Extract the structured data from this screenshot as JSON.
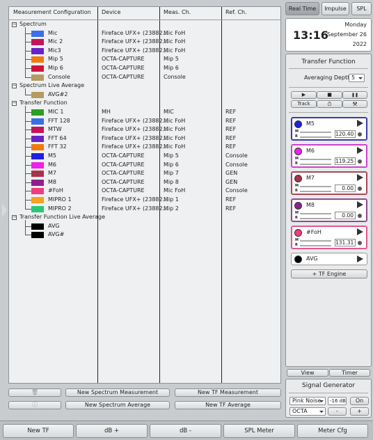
{
  "tree": {
    "headers": [
      "Measurement Configuration",
      "Device",
      "Meas. Ch.",
      "Ref. Ch."
    ],
    "groups": [
      {
        "label": "Spectrum",
        "toggle": "−",
        "items": [
          {
            "name": "Mic",
            "color": "#3a6fe8",
            "device": "Fireface UFX+ (23882...",
            "meas": "Mic FoH",
            "ref": ""
          },
          {
            "name": "Mic 2",
            "color": "#c4145a",
            "device": "Fireface UFX+ (23882...",
            "meas": "Mic FoH",
            "ref": ""
          },
          {
            "name": "Mic3",
            "color": "#6a22c8",
            "device": "Fireface UFX+ (23882...",
            "meas": "Mic FoH",
            "ref": ""
          },
          {
            "name": "Mip 5",
            "color": "#f07a10",
            "device": "OCTA-CAPTURE",
            "meas": "Mip 5",
            "ref": ""
          },
          {
            "name": "Mip 6",
            "color": "#d0123a",
            "device": "OCTA-CAPTURE",
            "meas": "Mip 6",
            "ref": ""
          },
          {
            "name": "Console",
            "color": "#b59a62",
            "device": "OCTA-CAPTURE",
            "meas": "Console",
            "ref": ""
          }
        ]
      },
      {
        "label": "Spectrum Live Average",
        "toggle": "−",
        "items": [
          {
            "name": "AVG#2",
            "color": "#b59a62",
            "device": "",
            "meas": "",
            "ref": ""
          }
        ]
      },
      {
        "label": "Transfer Function",
        "toggle": "−",
        "items": [
          {
            "name": "MIC 1",
            "color": "#2aa020",
            "device": "MH",
            "meas": "MIC",
            "ref": "REF"
          },
          {
            "name": "FFT 128",
            "color": "#3a6fe8",
            "device": "Fireface UFX+ (23882...",
            "meas": "Mic FoH",
            "ref": "REF"
          },
          {
            "name": "MTW",
            "color": "#c4145a",
            "device": "Fireface UFX+ (23882...",
            "meas": "Mic FoH",
            "ref": "REF"
          },
          {
            "name": "FFT 64",
            "color": "#6a22c8",
            "device": "Fireface UFX+ (23882...",
            "meas": "Mic FoH",
            "ref": "REF"
          },
          {
            "name": "FFT 32",
            "color": "#f07a10",
            "device": "Fireface UFX+ (23882...",
            "meas": "Mic FoH",
            "ref": "REF"
          },
          {
            "name": "M5",
            "color": "#2020e0",
            "device": "OCTA-CAPTURE",
            "meas": "Mip 5",
            "ref": "Console"
          },
          {
            "name": "M6",
            "color": "#f020e8",
            "device": "OCTA-CAPTURE",
            "meas": "Mip 6",
            "ref": "Console"
          },
          {
            "name": "M7",
            "color": "#a83248",
            "device": "OCTA-CAPTURE",
            "meas": "Mip 7",
            "ref": "GEN"
          },
          {
            "name": "M8",
            "color": "#902090",
            "device": "OCTA-CAPTURE",
            "meas": "Mip 8",
            "ref": "GEN"
          },
          {
            "name": "#FoH",
            "color": "#f03c80",
            "device": "OCTA-CAPTURE",
            "meas": "Mic FoH",
            "ref": "Console"
          },
          {
            "name": "MIPRO 1",
            "color": "#f8a020",
            "device": "Fireface UFX+ (23882...",
            "meas": "Mip 1",
            "ref": "REF"
          },
          {
            "name": "MIPRO 2",
            "color": "#28c878",
            "device": "Fireface UFX+ (23882...",
            "meas": "Mip 2",
            "ref": "REF"
          }
        ]
      },
      {
        "label": "Transfer Function Live Average",
        "toggle": "−",
        "items": [
          {
            "name": "AVG",
            "color": "#000000",
            "device": "",
            "meas": "",
            "ref": ""
          },
          {
            "name": "AVG#",
            "color": "#000000",
            "device": "",
            "meas": "",
            "ref": ""
          }
        ]
      }
    ]
  },
  "actions": {
    "trash_icon": "🗑",
    "info_icon": "ⓘ",
    "new_spectrum_measurement": "New Spectrum Measurement",
    "new_tf_measurement": "New TF Measurement",
    "new_spectrum_average": "New Spectrum Average",
    "new_tf_average": "New TF Average"
  },
  "mode_tabs": [
    "Real Time",
    "Impulse",
    "SPL"
  ],
  "clock": {
    "time": "13:16",
    "weekday": "Monday",
    "date": "September 26",
    "year": "2022"
  },
  "tf_panel": {
    "title": "Transfer Function",
    "averaging_label": "Averaging Depth:",
    "averaging_value": "5",
    "transport": {
      "play": "▶",
      "stop": "■",
      "pause": "❚❚"
    },
    "track_label": "Track",
    "timer_icon": "⏱",
    "tools_icon": "⚒",
    "channels": [
      {
        "name": "M5",
        "color": "#2020e0",
        "value": "120.40",
        "border": "#3a3aa8"
      },
      {
        "name": "M6",
        "color": "#f020e8",
        "value": "119.25",
        "border": "#d040d0"
      },
      {
        "name": "M7",
        "color": "#a83248",
        "value": "0.00",
        "border": "#a84858"
      },
      {
        "name": "M8",
        "color": "#902090",
        "value": "0.00",
        "border": "#904890"
      },
      {
        "name": "#FoH",
        "color": "#f03c80",
        "value": "131.31",
        "border": "#e05890"
      }
    ],
    "avg_channel": {
      "name": "AVG",
      "color": "#000000"
    },
    "m_label": "M",
    "r_label": "R",
    "tf_engine_label": "+ TF Engine"
  },
  "view_tabs": [
    "View",
    "Timer"
  ],
  "signal_generator": {
    "title": "Signal Generator",
    "type": "Pink Noise",
    "level": "-16 dB",
    "on_label": "On",
    "output": "OCTA",
    "minus": "-",
    "plus": "+"
  },
  "bottom_bar": [
    "New TF",
    "dB +",
    "dB -",
    "SPL Meter",
    "Meter Cfg"
  ]
}
